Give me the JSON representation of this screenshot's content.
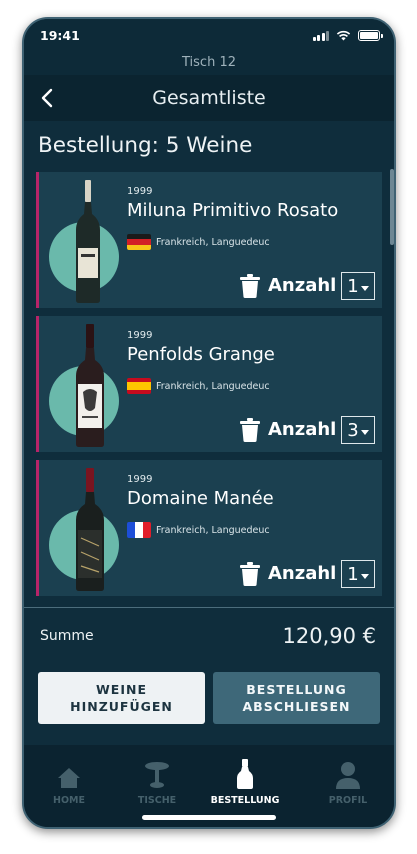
{
  "status": {
    "time": "19:41"
  },
  "table_label": "Tisch 12",
  "nav": {
    "title": "Gesamtliste"
  },
  "heading": "Bestellung: 5 Weine",
  "wines": [
    {
      "year": "1999",
      "name": "Miluna Primitivo Rosato",
      "origin": "Frankreich, Languedeuc",
      "flag": "germany",
      "quantity_label": "Anzahl",
      "quantity": "1",
      "bottle_color": "#1e2a28",
      "label_color": "#e8e4d6"
    },
    {
      "year": "1999",
      "name": "Penfolds Grange",
      "origin": "Frankreich, Languedeuc",
      "flag": "spain",
      "quantity_label": "Anzahl",
      "quantity": "3",
      "bottle_color": "#2a1d1e",
      "label_color": "#f2f0ec"
    },
    {
      "year": "1999",
      "name": "Domaine Manée",
      "origin": "Frankreich, Languedeuc",
      "flag": "france",
      "quantity_label": "Anzahl",
      "quantity": "1",
      "bottle_color": "#1a1f1e",
      "label_color": "#2b2f2c"
    }
  ],
  "summary": {
    "label": "Summe",
    "value": "120,90 €"
  },
  "buttons": {
    "add": "WEINE\nHINZUFÜGEN",
    "order": "BESTELLUNG\nABSCHLIESEN"
  },
  "tabs": [
    {
      "label": "HOME",
      "icon": "home-icon",
      "active": false
    },
    {
      "label": "TISCHE",
      "icon": "table-icon",
      "active": false
    },
    {
      "label": "BESTELLUNG",
      "icon": "bottle-icon",
      "active": true
    },
    {
      "label": "PROFIL",
      "icon": "profile-icon",
      "active": false
    }
  ],
  "colors": {
    "accent": "#b72469",
    "background": "#0f2d3c",
    "card": "#1b4050",
    "circle": "#6ab9ab"
  }
}
